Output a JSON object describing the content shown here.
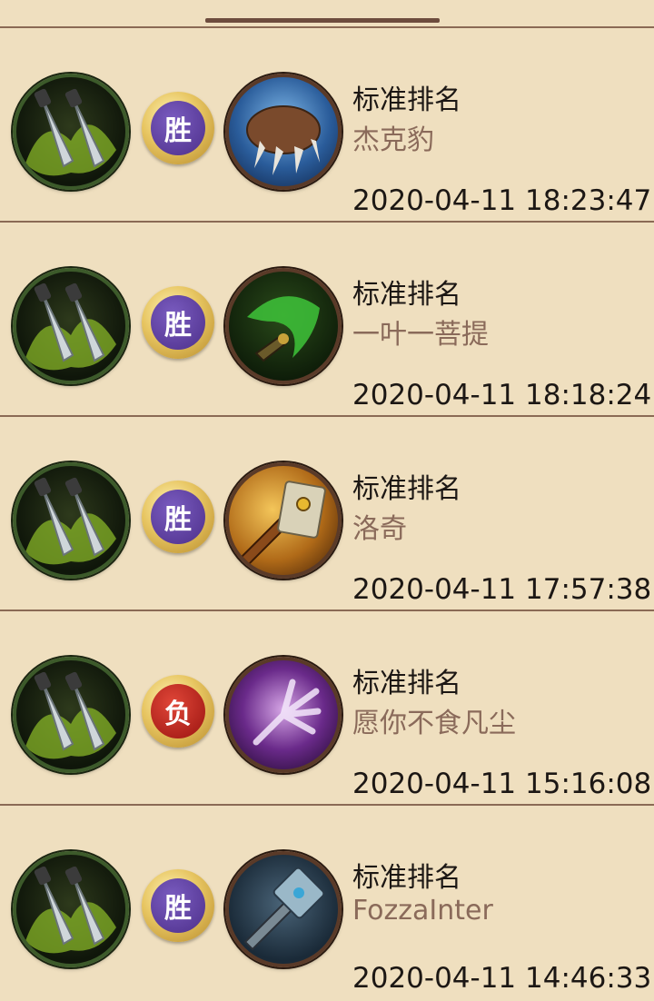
{
  "colors": {
    "background": "#efdfbf",
    "divider": "#8a6a55",
    "opponent_name": "#8a6a5a",
    "win_badge": "#4d2f8a",
    "loss_badge": "#9a1410"
  },
  "matches": [
    {
      "mode": "标准排名",
      "opponent": "杰克豹",
      "time": "2020-04-11 18:23:47",
      "result": "胜",
      "result_type": "win",
      "hero_icon": "twin-daggers-icon",
      "opponent_icon": "beast-claw-icon"
    },
    {
      "mode": "标准排名",
      "opponent": "一叶一菩提",
      "time": "2020-04-11 18:18:24",
      "result": "胜",
      "result_type": "win",
      "hero_icon": "twin-daggers-icon",
      "opponent_icon": "green-scythe-icon"
    },
    {
      "mode": "标准排名",
      "opponent": "洛奇",
      "time": "2020-04-11 17:57:38",
      "result": "胜",
      "result_type": "win",
      "hero_icon": "twin-daggers-icon",
      "opponent_icon": "golden-hammer-icon"
    },
    {
      "mode": "标准排名",
      "opponent": "愿你不食凡尘",
      "time": "2020-04-11 15:16:08",
      "result": "负",
      "result_type": "loss",
      "hero_icon": "twin-daggers-icon",
      "opponent_icon": "shadow-hand-icon"
    },
    {
      "mode": "标准排名",
      "opponent": "FozzaInter",
      "time": "2020-04-11 14:46:33",
      "result": "胜",
      "result_type": "win",
      "hero_icon": "twin-daggers-icon",
      "opponent_icon": "frost-hammer-icon"
    }
  ]
}
